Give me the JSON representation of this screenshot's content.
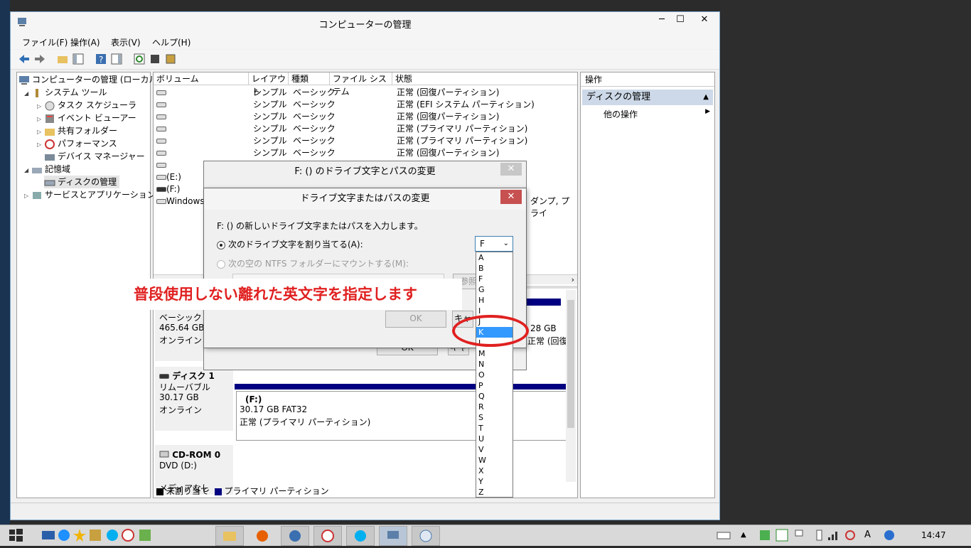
{
  "window": {
    "title": "コンピューターの管理",
    "min": "─",
    "max": "☐",
    "close": "✕"
  },
  "menu": [
    "ファイル(F)",
    "操作(A)",
    "表示(V)",
    "ヘルプ(H)"
  ],
  "tree": {
    "root": "コンピューターの管理 (ローカル)",
    "system_tools": "システム ツール",
    "task_scheduler": "タスク スケジューラ",
    "event_viewer": "イベント ビューアー",
    "shared_folders": "共有フォルダー",
    "performance": "パフォーマンス",
    "device_manager": "デバイス マネージャー",
    "storage": "記憶域",
    "disk_management": "ディスクの管理",
    "services": "サービスとアプリケーション"
  },
  "columns": [
    "ボリューム",
    "レイアウト",
    "種類",
    "ファイル システム",
    "状態"
  ],
  "volumes": [
    {
      "name": "",
      "layout": "シンプル",
      "type": "ベーシック",
      "fs": "",
      "status": "正常 (回復パーティション)"
    },
    {
      "name": "",
      "layout": "シンプル",
      "type": "ベーシック",
      "fs": "",
      "status": "正常 (EFI システム パーティション)"
    },
    {
      "name": "",
      "layout": "シンプル",
      "type": "ベーシック",
      "fs": "",
      "status": "正常 (回復パーティション)"
    },
    {
      "name": "",
      "layout": "シンプル",
      "type": "ベーシック",
      "fs": "",
      "status": "正常 (プライマリ パーティション)"
    },
    {
      "name": "",
      "layout": "シンプル",
      "type": "ベーシック",
      "fs": "",
      "status": "正常 (プライマリ パーティション)"
    },
    {
      "name": "",
      "layout": "シンプル",
      "type": "ベーシック",
      "fs": "",
      "status": "正常 (回復パーティション)"
    }
  ],
  "extra_volumes": [
    "",
    "(E:)",
    "(F:)",
    "Windows"
  ],
  "status_partial": "ダンプ, プライ",
  "disk0": {
    "type": "ベーシック",
    "size": "465.64 GB",
    "state": "オンライン",
    "right_size": "28 GB",
    "right_status": "正常 (回復"
  },
  "disk1": {
    "name": "ディスク 1",
    "type": "リムーバブル",
    "size": "30.17 GB",
    "state": "オンライン",
    "part_name": "(F:)",
    "part_info": "30.17 GB FAT32",
    "part_status": "正常 (プライマリ パーティション)"
  },
  "cdrom": {
    "name": "CD-ROM 0",
    "type": "DVD (D:)",
    "media": "メディアなし"
  },
  "legend": {
    "unallocated": "未割り当て",
    "primary": "プライマリ パーティション"
  },
  "actions": {
    "header": "操作",
    "selected": "ディスクの管理",
    "more": "他の操作"
  },
  "dialog_outer": {
    "title": "F: () のドライブ文字とパスの変更",
    "ok": "OK",
    "cancel": "キャンセル"
  },
  "dialog_inner": {
    "title": "ドライブ文字またはパスの変更",
    "prompt": "F: () の新しいドライブ文字またはパスを入力します。",
    "radio_letter": "次のドライブ文字を割り当てる(A):",
    "radio_mount": "次の空の NTFS フォルダーにマウントする(M):",
    "browse": "参照...",
    "ok": "OK",
    "cancel": "キャ"
  },
  "combo": {
    "value": "F"
  },
  "letters": [
    "A",
    "B",
    "F",
    "G",
    "H",
    "I",
    "J",
    "K",
    "L",
    "M",
    "N",
    "O",
    "P",
    "Q",
    "R",
    "S",
    "T",
    "U",
    "V",
    "W",
    "X",
    "Y",
    "Z"
  ],
  "selected_letter": "K",
  "annotation": "普段使用しない離れた英文字を指定します",
  "clock": "14:47",
  "colors": {
    "accent": "#3399ff",
    "annotation": "#e02020",
    "primary_partition": "#000080"
  }
}
